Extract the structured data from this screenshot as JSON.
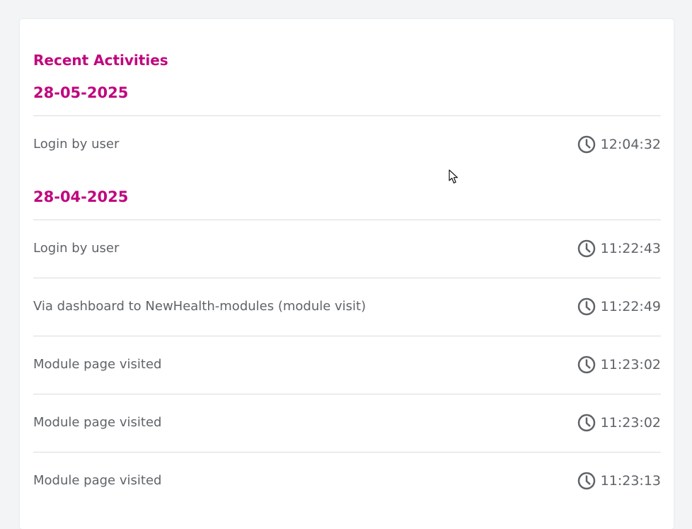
{
  "card": {
    "title": "Recent Activities"
  },
  "groups": [
    {
      "date": "28-05-2025",
      "items": [
        {
          "label": "Login by user",
          "time": "12:04:32"
        }
      ]
    },
    {
      "date": "28-04-2025",
      "items": [
        {
          "label": "Login by user",
          "time": "11:22:43"
        },
        {
          "label": "Via dashboard to NewHealth-modules (module visit)",
          "time": "11:22:49"
        },
        {
          "label": "Module page visited",
          "time": "11:23:02"
        },
        {
          "label": "Module page visited",
          "time": "11:23:02"
        },
        {
          "label": "Module page visited",
          "time": "11:23:13"
        }
      ]
    }
  ],
  "icons": {
    "time": "clock-icon",
    "pointer": "mouse-cursor-icon"
  },
  "colors": {
    "accent": "#c0057e",
    "text": "#5f6368",
    "divider": "#dcdcdc",
    "background": "#f3f4f6",
    "card": "#ffffff"
  }
}
